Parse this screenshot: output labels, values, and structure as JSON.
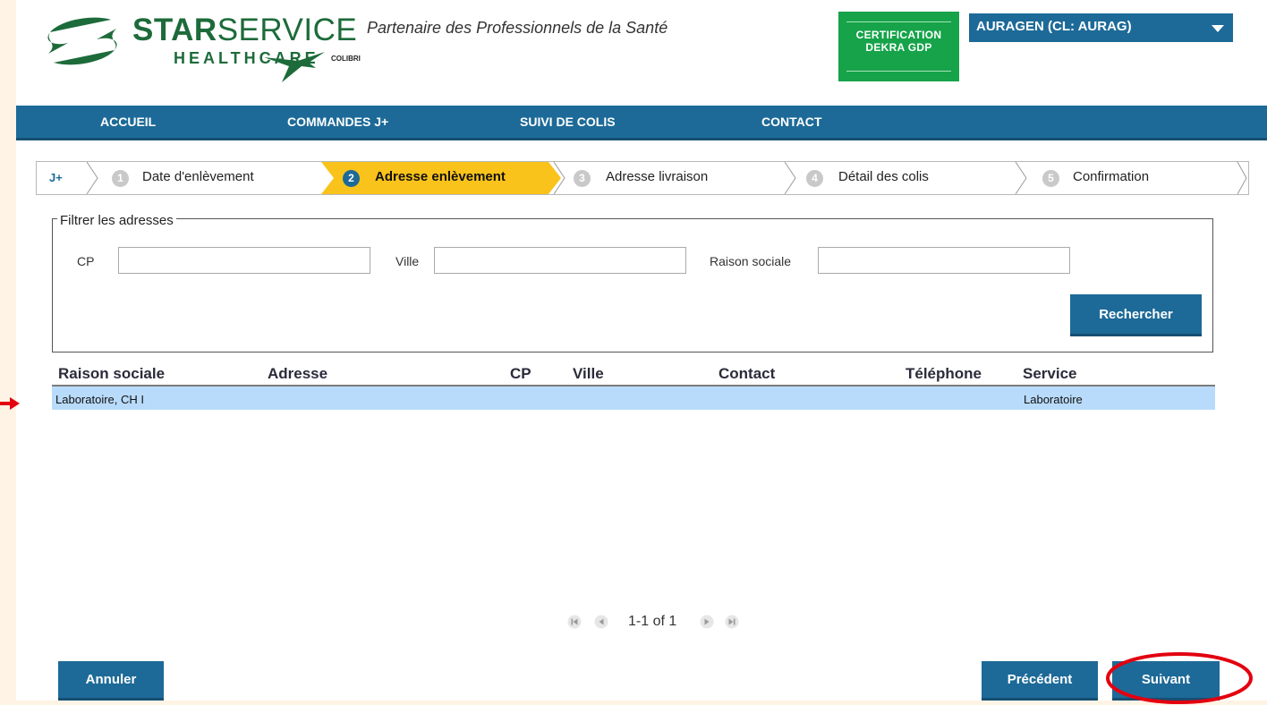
{
  "header": {
    "brand_bold": "STAR",
    "brand_light": "SERVICE",
    "brand_sub": "HEALTHCARE",
    "tagline": "Partenaire des Professionnels de la Santé",
    "colibri": "COLIBRI",
    "cert_line1": "CERTIFICATION",
    "cert_line2": "DEKRA GDP",
    "account_selector": "AURAGEN (CL: AURAG)"
  },
  "nav": {
    "items": [
      "ACCUEIL",
      "COMMANDES J+",
      "SUIVI DE COLIS",
      "CONTACT"
    ]
  },
  "stepper": {
    "prefix": "J+",
    "steps": [
      {
        "num": "1",
        "label": "Date d'enlèvement"
      },
      {
        "num": "2",
        "label": "Adresse enlèvement"
      },
      {
        "num": "3",
        "label": "Adresse livraison"
      },
      {
        "num": "4",
        "label": "Détail des colis"
      },
      {
        "num": "5",
        "label": "Confirmation"
      }
    ],
    "active_index": 1
  },
  "filter": {
    "legend": "Filtrer les adresses",
    "cp_label": "CP",
    "cp_value": "",
    "ville_label": "Ville",
    "ville_value": "",
    "raison_label": "Raison sociale",
    "raison_value": "",
    "search_button": "Rechercher"
  },
  "table": {
    "columns": [
      "Raison sociale",
      "Adresse",
      "CP",
      "Ville",
      "Contact",
      "Téléphone",
      "Service"
    ],
    "rows": [
      {
        "raison_sociale": "Laboratoire, CH I",
        "adresse": "",
        "cp": "",
        "ville": "",
        "contact": "",
        "telephone": "",
        "service": "Laboratoire"
      }
    ],
    "selected_row": 0
  },
  "pagination": {
    "text": "1-1 of 1"
  },
  "footer": {
    "cancel": "Annuler",
    "previous": "Précédent",
    "next": "Suivant"
  },
  "colors": {
    "primary_blue": "#1d6a98",
    "active_step": "#fac31b",
    "selected_row": "#b9dbfb",
    "cert_green": "#16a34a",
    "brand_green": "#1d6b3a",
    "annotation_red": "#e3000f"
  }
}
